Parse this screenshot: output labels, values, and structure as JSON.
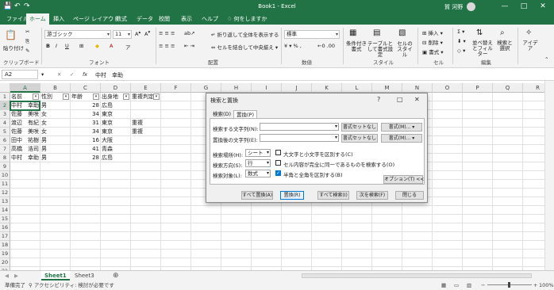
{
  "titlebar": {
    "autosave_icon": "save-icon",
    "undo_icon": "undo-icon",
    "redo_icon": "redo-icon",
    "doc_title": "Book1  -  Excel",
    "user": "賀 河野",
    "user_initial": "",
    "minimize": "—",
    "maximize": "□",
    "close": "✕"
  },
  "menu": [
    "ファイル",
    "ホーム",
    "挿入",
    "ページ レイアウト",
    "数式",
    "データ",
    "校閲",
    "表示",
    "ヘルプ",
    "何をしますか"
  ],
  "ribbon": {
    "clipboard": {
      "label": "クリップボード",
      "paste": "貼り付け"
    },
    "font": {
      "label": "フォント",
      "name": "游ゴシック",
      "size": "11"
    },
    "align": {
      "label": "配置",
      "wrap": "折り返して全体を表示する",
      "merge": "セルを結合して中央揃え"
    },
    "number": {
      "label": "数値",
      "format": "標準"
    },
    "style": {
      "label": "スタイル",
      "cond": "条件付き書式",
      "table": "テーブルとして書式設定",
      "cell": "セルのスタイル"
    },
    "cells": {
      "label": "セル",
      "insert": "挿入",
      "delete": "削除",
      "format": "書式"
    },
    "edit": {
      "label": "編集",
      "sort": "並べ替えとフィルター",
      "find": "検索と選択"
    },
    "ai": {
      "label": "",
      "idea": "アイデア"
    }
  },
  "formula": {
    "namebox": "A2",
    "fx": "fx",
    "content": "中村　幸助",
    "cancel": "✕",
    "enter": "✓"
  },
  "columns": [
    "A",
    "B",
    "C",
    "D",
    "E",
    "F",
    "G",
    "H",
    "I",
    "J",
    "K",
    "L",
    "M",
    "N",
    "O",
    "P",
    "Q",
    "R"
  ],
  "rows": [
    "1",
    "2",
    "3",
    "4",
    "5",
    "6",
    "7",
    "8",
    "9",
    "10",
    "11",
    "12",
    "13",
    "14",
    "15",
    "16",
    "17",
    "18",
    "19",
    "20",
    "21"
  ],
  "table": {
    "headers": [
      "名前",
      "性別",
      "年齢",
      "出身地",
      "重複判定"
    ],
    "rows": [
      [
        "中村　幸助",
        "男",
        "28",
        "広島",
        ""
      ],
      [
        "佐藤　美咲",
        "女",
        "34",
        "東京",
        ""
      ],
      [
        "渡辺　有紀",
        "女",
        "31",
        "東京",
        "重複"
      ],
      [
        "佐藤　美咲",
        "女",
        "34",
        "東京",
        "重複"
      ],
      [
        "田中　祐樹",
        "男",
        "16",
        "大阪",
        ""
      ],
      [
        "高橋　浩司",
        "男",
        "41",
        "青森",
        ""
      ],
      [
        "中村　幸助",
        "男",
        "28",
        "広島",
        ""
      ]
    ]
  },
  "sheets": [
    "Sheet1",
    "Sheet3"
  ],
  "status": {
    "ready": "準備完了",
    "access": "アクセシビリティ: 検討が必要です",
    "zoom": "100%"
  },
  "dialog": {
    "title": "検索と置換",
    "help": "?",
    "tabs": [
      "検索(D)",
      "置換(P)"
    ],
    "find_label": "検索する文字列(N):",
    "replace_label": "置換後の文字列(E):",
    "no_format": "書式セットなし",
    "format_btn": "書式(M)...",
    "within_label": "検索場所(H):",
    "within": "シート",
    "search_label": "検索方向(S):",
    "search": "行",
    "lookin_label": "検索対象(L):",
    "lookin": "数式",
    "match_case": "大文字と小文字を区別する(C)",
    "match_entire": "セル内容が完全に同一であるものを検索する(O)",
    "match_width": "半角と全角を区別する(B)",
    "options": "オプション(T) <<",
    "replace_all": "すべて置換(A)",
    "replace": "置換(R)",
    "find_all": "すべて検索(I)",
    "find_next": "次を検索(F)",
    "close": "閉じる"
  }
}
